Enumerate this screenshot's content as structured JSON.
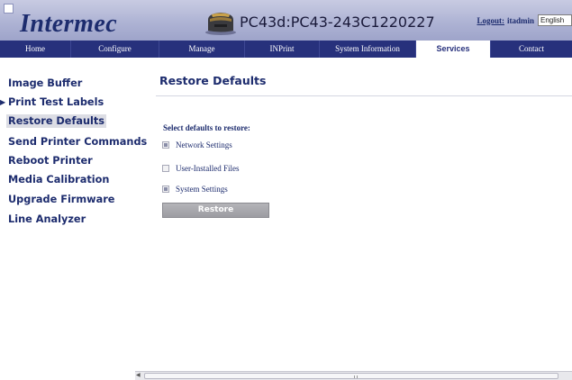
{
  "header": {
    "logo": "Intermec",
    "device_title": "PC43d:PC43-243C1220227",
    "logout_label": "Logout:",
    "user": "itadmin",
    "language": "English"
  },
  "nav": {
    "items": [
      {
        "label": "Home"
      },
      {
        "label": "Configure"
      },
      {
        "label": "Manage"
      },
      {
        "label": "INPrint"
      },
      {
        "label": "System Information"
      },
      {
        "label": "Services"
      },
      {
        "label": "Contact"
      }
    ],
    "active": "Services"
  },
  "sidebar": {
    "items": [
      {
        "label": "Image Buffer"
      },
      {
        "label": "Print Test Labels"
      },
      {
        "label": "Restore Defaults"
      },
      {
        "label": "Send Printer Commands"
      },
      {
        "label": "Reboot Printer"
      },
      {
        "label": "Media Calibration"
      },
      {
        "label": "Upgrade Firmware"
      },
      {
        "label": "Line Analyzer"
      }
    ],
    "active": "Restore Defaults",
    "expandable": "Print Test Labels"
  },
  "main": {
    "title": "Restore Defaults",
    "section_label": "Select defaults to restore:",
    "options": [
      {
        "label": "Network Settings",
        "checked": true
      },
      {
        "label": "User-Installed Files",
        "checked": false
      },
      {
        "label": "System Settings",
        "checked": true
      }
    ],
    "restore_button": "Restore"
  },
  "colors": {
    "navy": "#27317c",
    "text_blue": "#1d2c6e",
    "header_bg": "#aeb3d4"
  }
}
